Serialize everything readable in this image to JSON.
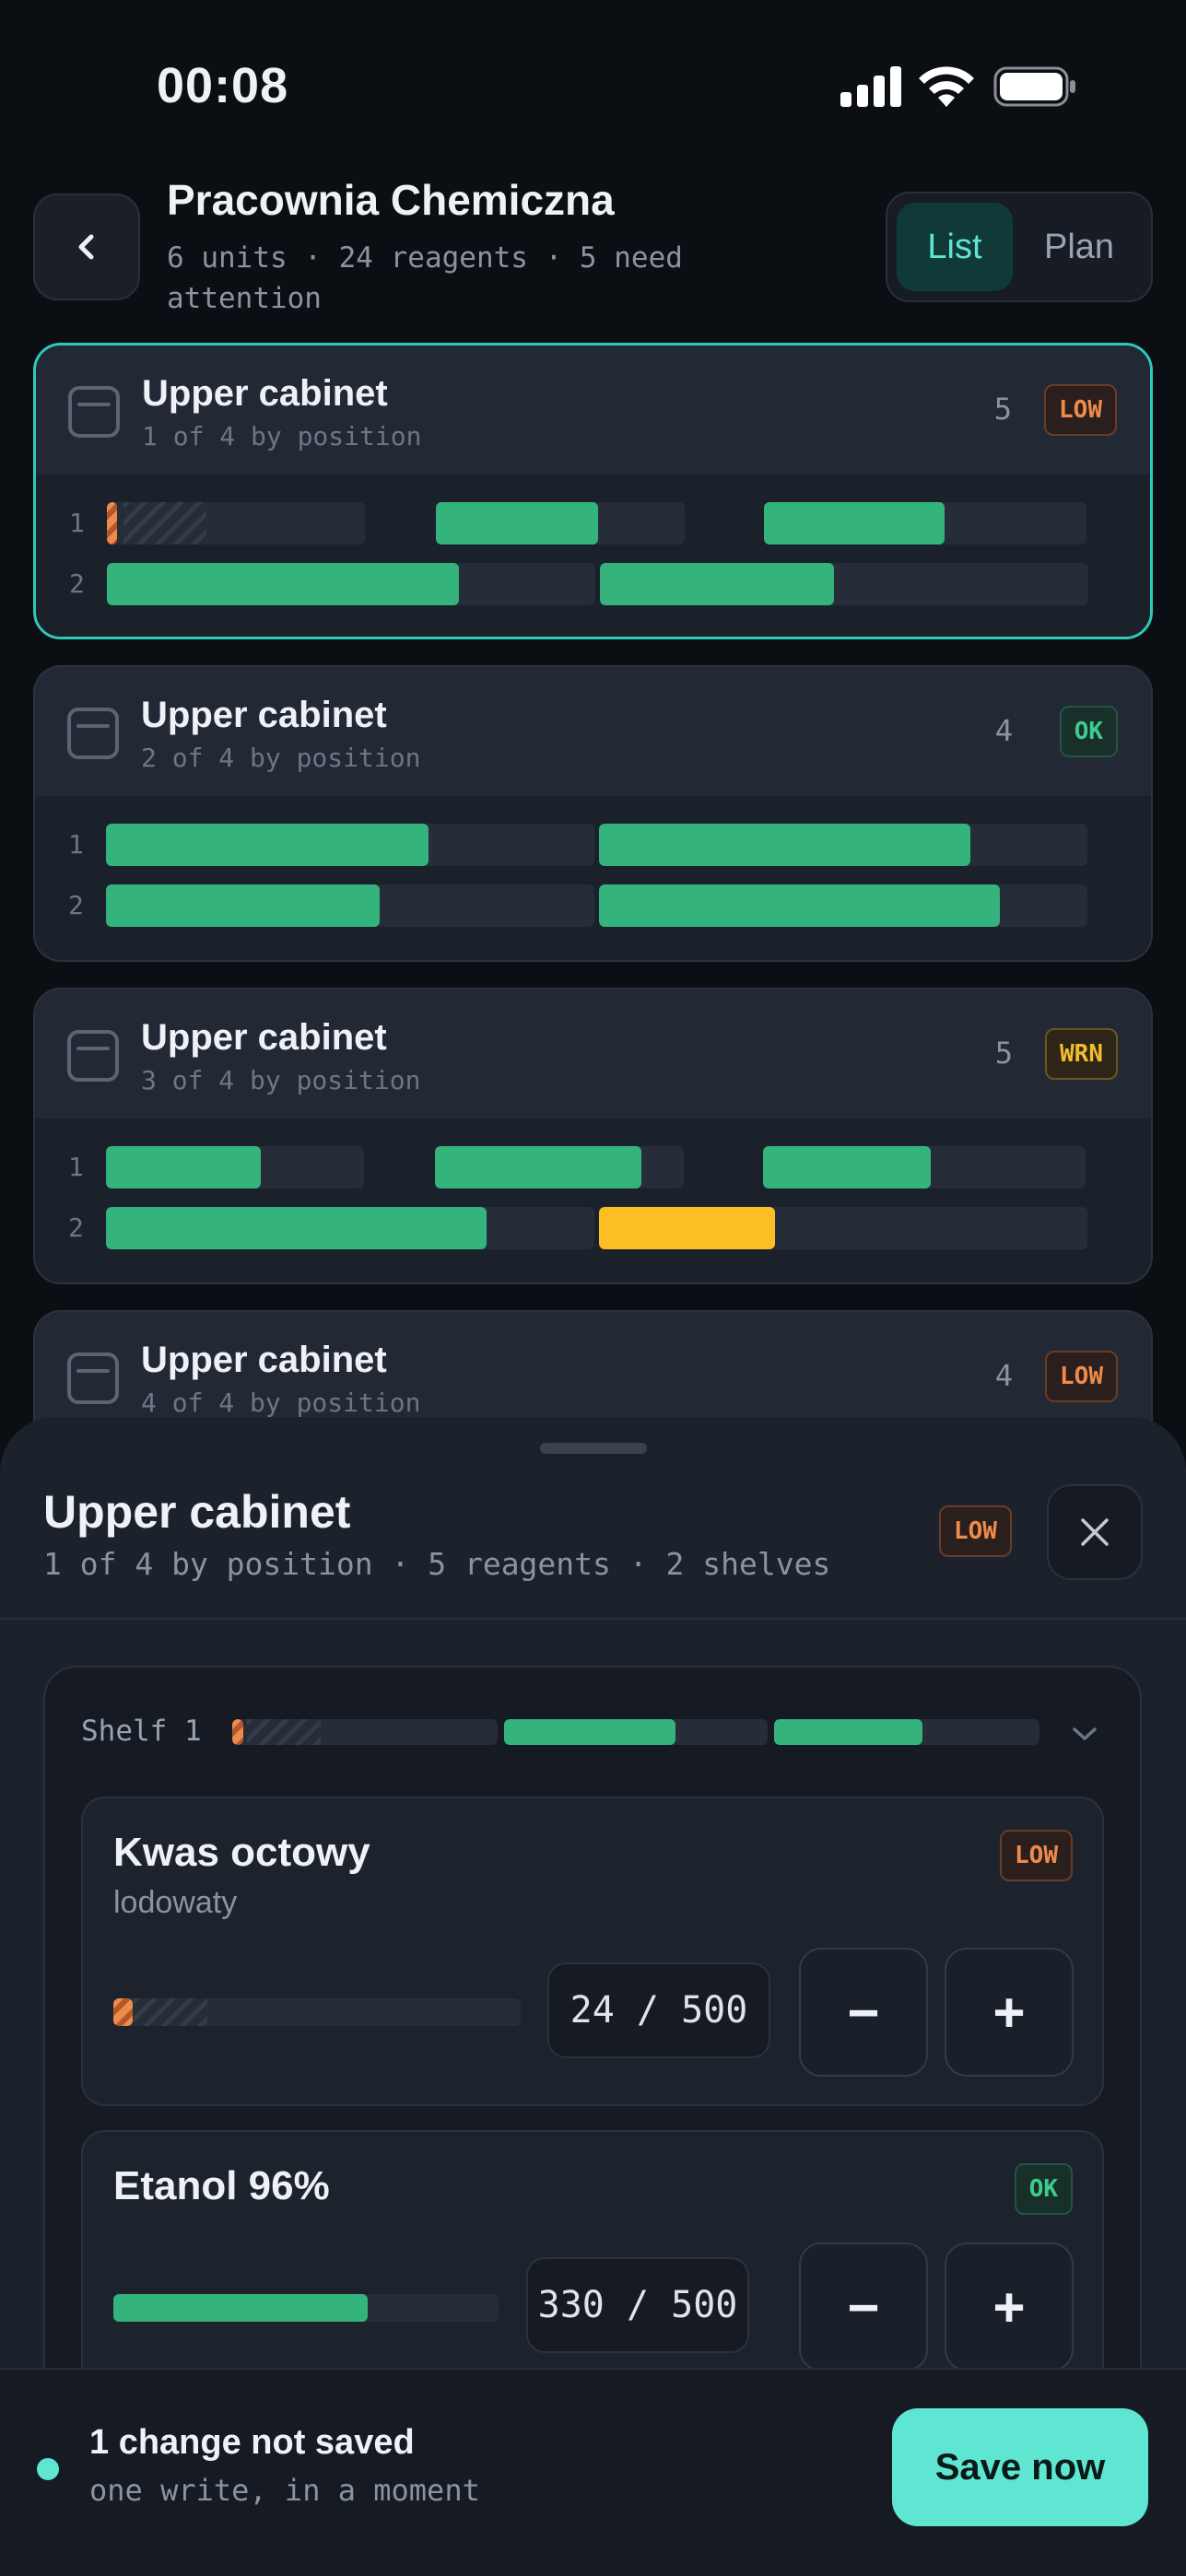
{
  "status_bar": {
    "time": "00:08"
  },
  "header": {
    "title": "Pracownia Chemiczna",
    "subtitle": "6 units · 24 reagents · 5 need attention",
    "view_toggle": {
      "list": "List",
      "plan": "Plan",
      "selected": "List"
    }
  },
  "cabinets": [
    {
      "title": "Upper cabinet",
      "position": "1 of 4 by position",
      "count": "5",
      "status": "LOW",
      "selected": true,
      "shelves": [
        {
          "label": "1",
          "segments": [
            {
              "level": 0.04,
              "state": "low"
            },
            {
              "level": 0.65,
              "state": "ok"
            },
            {
              "level": 0.56,
              "state": "ok"
            }
          ]
        },
        {
          "label": "2",
          "segments": [
            {
              "level": 0.72,
              "state": "ok"
            },
            {
              "level": 0.48,
              "state": "ok"
            }
          ]
        }
      ]
    },
    {
      "title": "Upper cabinet",
      "position": "2 of 4 by position",
      "count": "4",
      "status": "OK",
      "selected": false,
      "shelves": [
        {
          "label": "1",
          "segments": [
            {
              "level": 0.66,
              "state": "ok"
            },
            {
              "level": 0.76,
              "state": "ok"
            }
          ]
        },
        {
          "label": "2",
          "segments": [
            {
              "level": 0.56,
              "state": "ok"
            },
            {
              "level": 0.82,
              "state": "ok"
            }
          ]
        }
      ]
    },
    {
      "title": "Upper cabinet",
      "position": "3 of 4 by position",
      "count": "5",
      "status": "WRN",
      "selected": false,
      "shelves": [
        {
          "label": "1",
          "segments": [
            {
              "level": 0.6,
              "state": "ok"
            },
            {
              "level": 0.83,
              "state": "ok"
            },
            {
              "level": 0.52,
              "state": "ok"
            }
          ]
        },
        {
          "label": "2",
          "segments": [
            {
              "level": 0.78,
              "state": "ok"
            },
            {
              "level": 0.36,
              "state": "wrn"
            }
          ]
        }
      ]
    },
    {
      "title": "Upper cabinet",
      "position": "4 of 4 by position",
      "count": "4",
      "status": "LOW",
      "selected": false,
      "shelves": []
    }
  ],
  "sheet": {
    "title": "Upper cabinet",
    "subtitle": "1 of 4 by position · 5 reagents · 2 shelves",
    "status": "LOW",
    "shelf": {
      "label": "Shelf 1",
      "segments": [
        {
          "level": 0.04,
          "state": "low"
        },
        {
          "level": 0.65,
          "state": "ok"
        },
        {
          "level": 0.56,
          "state": "ok"
        }
      ]
    },
    "items": [
      {
        "name": "Kwas octowy",
        "sub": "lodowaty",
        "status": "LOW",
        "quantity": "24 / 500",
        "level": 0.048
      },
      {
        "name": "Etanol 96%",
        "sub": "",
        "status": "OK",
        "quantity": "330 / 500",
        "level": 0.66
      }
    ],
    "minus": "−",
    "plus": "+"
  },
  "footer": {
    "title": "1 change not saved",
    "subtitle": "one write, in a moment",
    "save": "Save now"
  },
  "colors": {
    "accent": "#5ee6d3",
    "ok": "#34b37d",
    "low": "#ef8b4a",
    "wrn": "#fbbf24"
  }
}
